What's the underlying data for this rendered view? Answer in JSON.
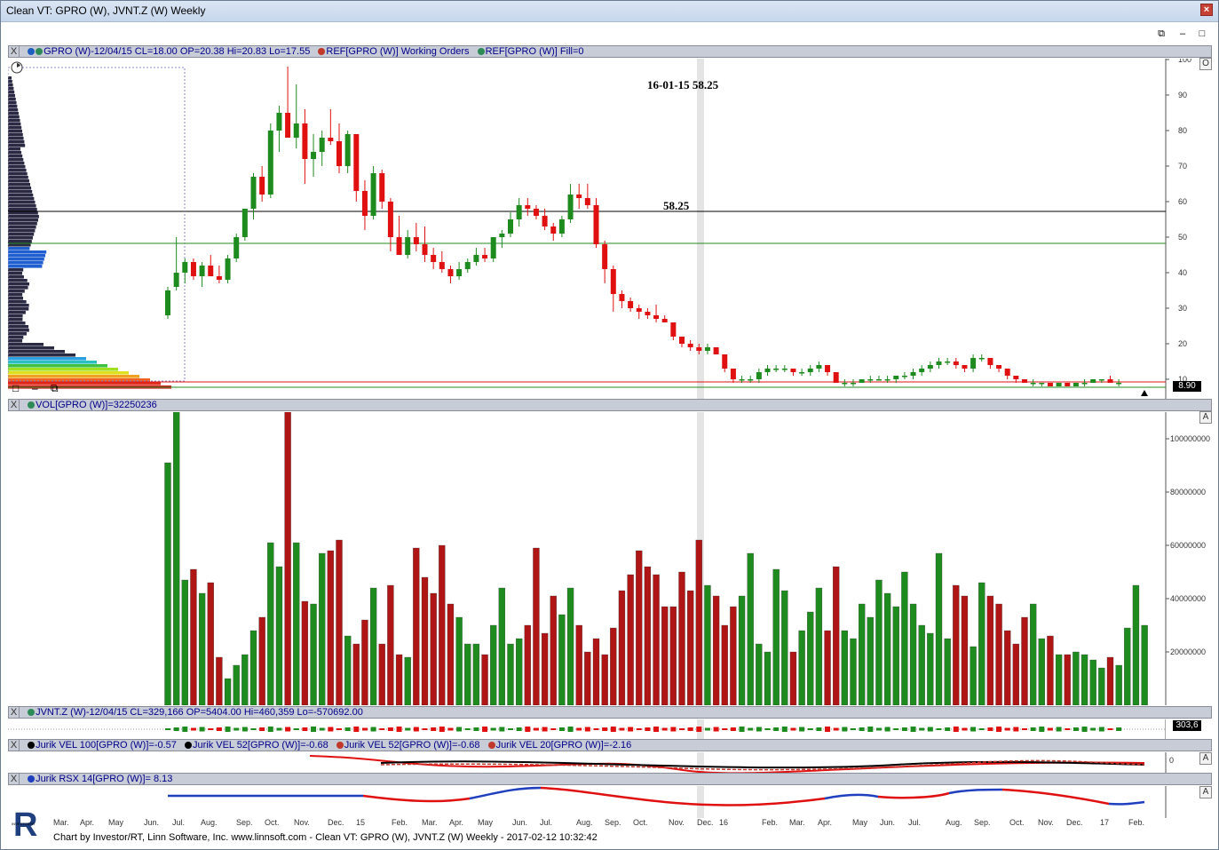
{
  "window": {
    "title": "Clean VT: GPRO (W), JVNT.Z (W) Weekly",
    "close_label": "×"
  },
  "mdi": {
    "restore": "⧉",
    "minimize": "–",
    "close": "□"
  },
  "panels": {
    "price": {
      "close_label": "X",
      "items": [
        {
          "text": "GPRO (W)-12/04/15 CL=18.00 OP=20.38 Hi=20.83 Lo=17.55",
          "color": "#2e8b57"
        },
        {
          "text": "REF[GPRO (W)] Working Orders",
          "color": "#c0392b"
        },
        {
          "text": "REF[GPRO (W)] Fill=0",
          "color": "#2e8b57"
        }
      ],
      "yticks": [
        "100",
        "90",
        "80",
        "70",
        "60",
        "50",
        "40",
        "30",
        "20",
        "10"
      ],
      "last_price": "8.90",
      "scale_btn": "O"
    },
    "volume": {
      "close_label": "X",
      "items": [
        {
          "text": "VOL[GPRO (W)]=32250236",
          "color": "#2e8b57"
        }
      ],
      "yticks": [
        "100000000",
        "80000000",
        "60000000",
        "40000000",
        "20000000"
      ],
      "scale_btn": "A"
    },
    "jvnt": {
      "close_label": "X",
      "items": [
        {
          "text": "JVNT.Z (W)-12/04/15 CL=329,166 OP=5404.00 Hi=460,359 Lo=-570692.00",
          "color": "#2e8b57"
        }
      ],
      "last_value": "303,6"
    },
    "jurik_vel": {
      "close_label": "X",
      "items": [
        {
          "text": "Jurik VEL 100[GPRO (W)]=-0.57",
          "color": "#000000"
        },
        {
          "text": "Jurik VEL 52[GPRO (W)]=-0.68",
          "color": "#000000"
        },
        {
          "text": "Jurik VEL 52[GPRO (W)]=-0.68",
          "color": "#c0392b"
        },
        {
          "text": "Jurik VEL 20[GPRO (W)]=-2.16",
          "color": "#c0392b"
        }
      ],
      "ytick": "0",
      "scale_btn": "A"
    },
    "jurik_rsx": {
      "close_label": "X",
      "items": [
        {
          "text": "Jurik RSX 14[GPRO (W)]= 8.13",
          "color": "#1f3fbf"
        }
      ],
      "scale_btn": "A"
    }
  },
  "annotations": {
    "date_price": "16-01-15  58.25",
    "level": "58.25"
  },
  "xaxis_labels": [
    "Mar.",
    "Apr.",
    "May",
    "Jun.",
    "Jul.",
    "Aug.",
    "Sep.",
    "Oct.",
    "Nov.",
    "Dec.",
    "15",
    "Feb.",
    "Mar.",
    "Apr.",
    "May",
    "Jun.",
    "Jul.",
    "Aug.",
    "Sep.",
    "Oct.",
    "Nov.",
    "Dec.",
    "16",
    "Feb.",
    "Mar.",
    "Apr.",
    "May",
    "Jun.",
    "Jul.",
    "Aug.",
    "Sep.",
    "Oct.",
    "Nov.",
    "Dec.",
    "17",
    "Feb."
  ],
  "footer": "Chart by Investor/RT, Linn Software, Inc. www.linnsoft.com - Clean VT: GPRO (W), JVNT.Z (W) Weekly - 2017-02-12 10:32:42",
  "logo_text": "INVESTOR/RT",
  "colors": {
    "up": "#1e8b1e",
    "down": "#e01010",
    "vol_up": "#1e8b1e",
    "vol_down": "#b01515"
  },
  "chart_data": {
    "type": "candlestick",
    "title": "GPRO (W)",
    "ylim": [
      0,
      100
    ],
    "vol_ylim": [
      0,
      110000000
    ],
    "candles": [
      [
        28,
        36,
        27,
        35
      ],
      [
        36,
        50,
        35,
        40
      ],
      [
        40,
        44,
        37,
        43
      ],
      [
        43,
        44,
        38,
        39
      ],
      [
        39,
        43,
        36,
        42
      ],
      [
        42,
        45,
        39,
        39
      ],
      [
        39,
        42,
        37,
        38
      ],
      [
        38,
        45,
        37,
        44
      ],
      [
        44,
        51,
        43,
        50
      ],
      [
        50,
        58,
        49,
        58
      ],
      [
        58,
        68,
        55,
        67
      ],
      [
        67,
        70,
        60,
        62
      ],
      [
        62,
        82,
        61,
        80
      ],
      [
        80,
        87,
        74,
        85
      ],
      [
        85,
        98,
        80,
        78
      ],
      [
        78,
        93,
        75,
        82
      ],
      [
        82,
        86,
        65,
        72
      ],
      [
        72,
        79,
        67,
        74
      ],
      [
        74,
        80,
        70,
        78
      ],
      [
        78,
        86,
        76,
        77
      ],
      [
        77,
        82,
        68,
        70
      ],
      [
        70,
        80,
        68,
        79
      ],
      [
        79,
        79,
        60,
        63
      ],
      [
        63,
        66,
        52,
        56
      ],
      [
        56,
        70,
        55,
        68
      ],
      [
        68,
        69,
        58,
        60
      ],
      [
        60,
        61,
        46,
        50
      ],
      [
        50,
        56,
        45,
        45
      ],
      [
        45,
        52,
        44,
        50
      ],
      [
        50,
        54,
        46,
        48
      ],
      [
        48,
        53,
        43,
        45
      ],
      [
        45,
        47,
        41,
        43
      ],
      [
        43,
        46,
        40,
        41
      ],
      [
        41,
        42,
        37,
        39
      ],
      [
        39,
        43,
        38,
        41
      ],
      [
        41,
        44,
        40,
        43
      ],
      [
        43,
        47,
        42,
        45
      ],
      [
        45,
        47,
        43,
        44
      ],
      [
        44,
        50,
        43,
        50
      ],
      [
        50,
        52,
        47,
        51
      ],
      [
        51,
        57,
        50,
        55
      ],
      [
        55,
        61,
        53,
        59
      ],
      [
        59,
        61,
        56,
        58
      ],
      [
        58,
        59,
        55,
        56
      ],
      [
        56,
        58,
        52,
        53
      ],
      [
        53,
        54,
        49,
        51
      ],
      [
        51,
        56,
        50,
        55
      ],
      [
        55,
        65,
        54,
        62
      ],
      [
        62,
        65,
        58,
        61
      ],
      [
        61,
        65,
        58,
        59
      ],
      [
        59,
        61,
        47,
        48
      ],
      [
        48,
        49,
        37,
        41
      ],
      [
        41,
        42,
        29,
        34
      ],
      [
        34,
        35,
        30,
        32
      ],
      [
        32,
        33,
        29,
        30
      ],
      [
        30,
        31,
        27,
        29
      ],
      [
        29,
        30,
        27,
        28
      ],
      [
        28,
        31,
        26,
        27
      ],
      [
        27,
        28,
        26,
        26
      ],
      [
        26,
        26,
        21,
        22
      ],
      [
        22,
        22,
        19,
        20
      ],
      [
        20,
        21,
        18,
        19
      ],
      [
        19,
        20,
        17,
        18
      ],
      [
        18,
        20,
        17,
        19
      ],
      [
        19,
        19,
        17,
        17
      ],
      [
        17,
        17,
        12,
        13
      ],
      [
        13,
        13,
        9,
        10
      ],
      [
        10,
        11,
        9,
        10
      ],
      [
        10,
        11,
        9,
        10
      ],
      [
        10,
        13,
        9,
        12
      ],
      [
        12,
        14,
        11,
        13
      ],
      [
        13,
        14,
        12,
        13
      ],
      [
        13,
        14,
        12,
        13
      ],
      [
        13,
        13,
        11,
        12
      ],
      [
        12,
        13,
        11,
        12
      ],
      [
        12,
        14,
        11,
        13
      ],
      [
        13,
        15,
        12,
        14
      ],
      [
        14,
        14,
        11,
        12
      ],
      [
        12,
        12,
        9,
        9
      ],
      [
        9,
        10,
        8,
        9
      ],
      [
        9,
        10,
        8,
        9
      ],
      [
        9,
        10,
        9,
        10
      ],
      [
        10,
        11,
        9,
        10
      ],
      [
        10,
        11,
        10,
        10
      ],
      [
        10,
        11,
        9,
        10
      ],
      [
        10,
        11,
        9,
        11
      ],
      [
        11,
        12,
        10,
        11
      ],
      [
        11,
        13,
        10,
        12
      ],
      [
        12,
        14,
        11,
        13
      ],
      [
        13,
        15,
        12,
        14
      ],
      [
        14,
        16,
        13,
        15
      ],
      [
        15,
        16,
        14,
        15
      ],
      [
        15,
        16,
        13,
        14
      ],
      [
        14,
        14,
        12,
        13
      ],
      [
        13,
        17,
        12,
        16
      ],
      [
        16,
        17,
        15,
        16
      ],
      [
        16,
        16,
        13,
        14
      ],
      [
        14,
        14,
        12,
        13
      ],
      [
        13,
        13,
        10,
        11
      ],
      [
        11,
        11,
        9,
        10
      ],
      [
        10,
        10,
        9,
        9
      ],
      [
        9,
        10,
        8,
        9
      ],
      [
        9,
        9,
        8,
        9
      ],
      [
        9,
        9,
        8,
        8
      ],
      [
        8,
        9,
        8,
        9
      ],
      [
        9,
        9,
        8,
        8
      ],
      [
        8,
        9,
        8,
        9
      ],
      [
        9,
        10,
        8,
        9
      ],
      [
        9,
        10,
        9,
        10
      ],
      [
        10,
        10,
        9,
        10
      ],
      [
        10,
        11,
        9,
        9
      ],
      [
        9,
        10,
        8,
        9
      ]
    ],
    "volume": [
      91,
      111,
      47,
      51,
      42,
      46,
      18,
      10,
      15,
      19,
      28,
      33,
      61,
      52,
      111,
      61,
      39,
      38,
      57,
      58,
      62,
      26,
      23,
      32,
      44,
      23,
      45,
      19,
      18,
      59,
      48,
      42,
      60,
      38,
      33,
      23,
      23,
      19,
      30,
      44,
      23,
      25,
      30,
      59,
      27,
      41,
      34,
      44,
      30,
      20,
      25,
      19,
      29,
      43,
      49,
      58,
      52,
      49,
      37,
      37,
      50,
      43,
      62,
      45,
      41,
      30,
      37,
      41,
      57,
      23,
      20,
      51,
      43,
      20,
      28,
      35,
      44,
      28,
      52,
      28,
      25,
      38,
      33,
      47,
      42,
      37,
      50,
      38,
      30,
      27,
      57,
      25,
      45,
      41,
      22,
      46,
      41,
      38,
      28,
      23,
      33,
      38,
      25,
      26,
      19,
      19,
      20,
      19,
      17,
      14,
      18,
      15,
      29,
      45,
      30
    ]
  }
}
